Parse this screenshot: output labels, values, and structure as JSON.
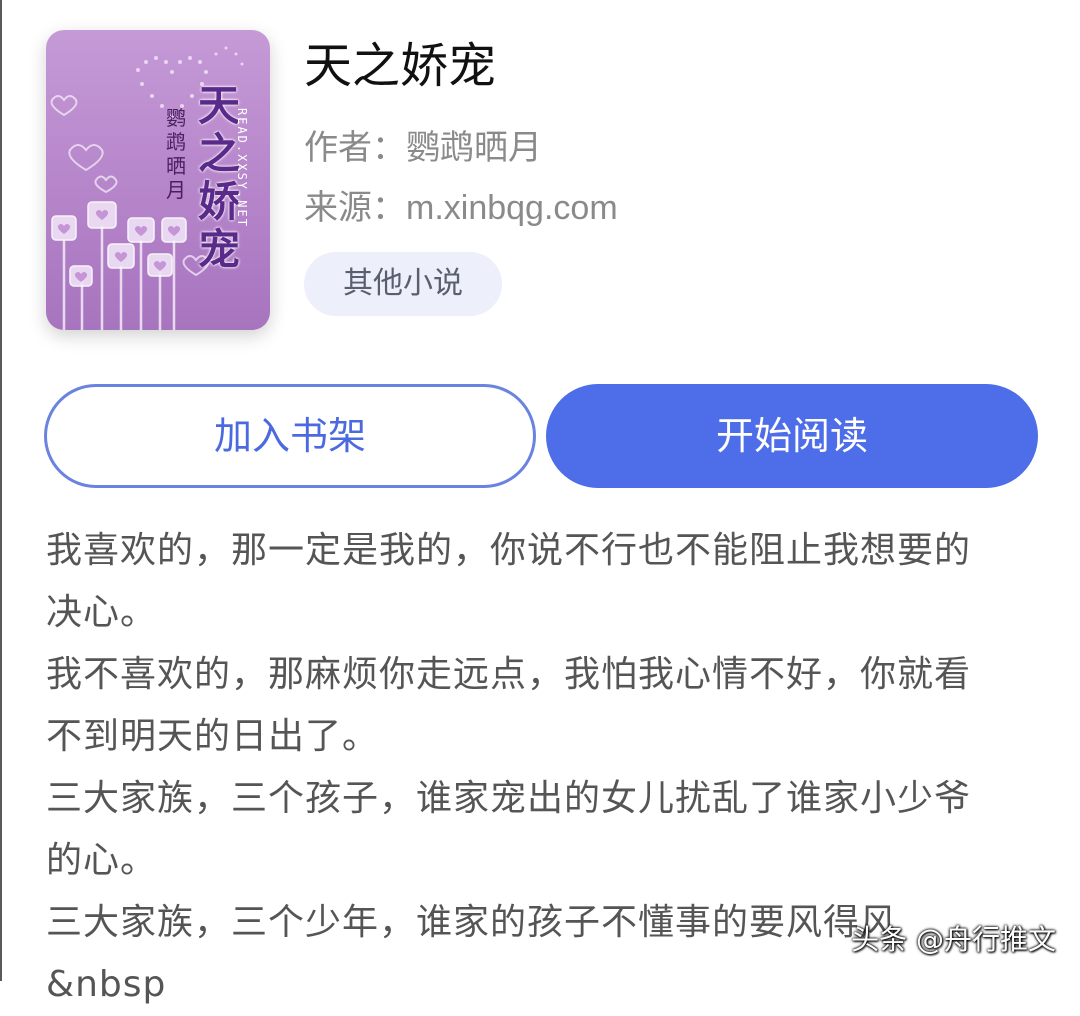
{
  "book": {
    "title": "天之娇宠",
    "author_label": "作者：",
    "author": "鹦鹉晒月",
    "source_label": "来源：",
    "source": "m.xinbqg.com",
    "tag": "其他小说",
    "cover": {
      "title_text": "天之娇宠",
      "author_text": "鹦鹉晒月",
      "site_text": "READ.XXSY.NET"
    }
  },
  "actions": {
    "add_to_shelf": "加入书架",
    "start_reading": "开始阅读"
  },
  "description": [
    "我喜欢的，那一定是我的，你说不行也不能阻止我想要的",
    "决心。",
    "我不喜欢的，那麻烦你走远点，我怕我心情不好，你就看",
    "不到明天的日出了。",
    "三大家族，三个孩子，谁家宠出的女儿扰乱了谁家小少爷",
    "的心。",
    "三大家族，三个少年，谁家的孩子不懂事的要风得风",
    "&nbsp"
  ],
  "watermark": "头条 @舟行推文",
  "colors": {
    "accent": "#4d6ee8",
    "tag_bg": "#edf0fa",
    "cover_purple": "#b888cc",
    "cover_title": "#5a2a8a"
  }
}
